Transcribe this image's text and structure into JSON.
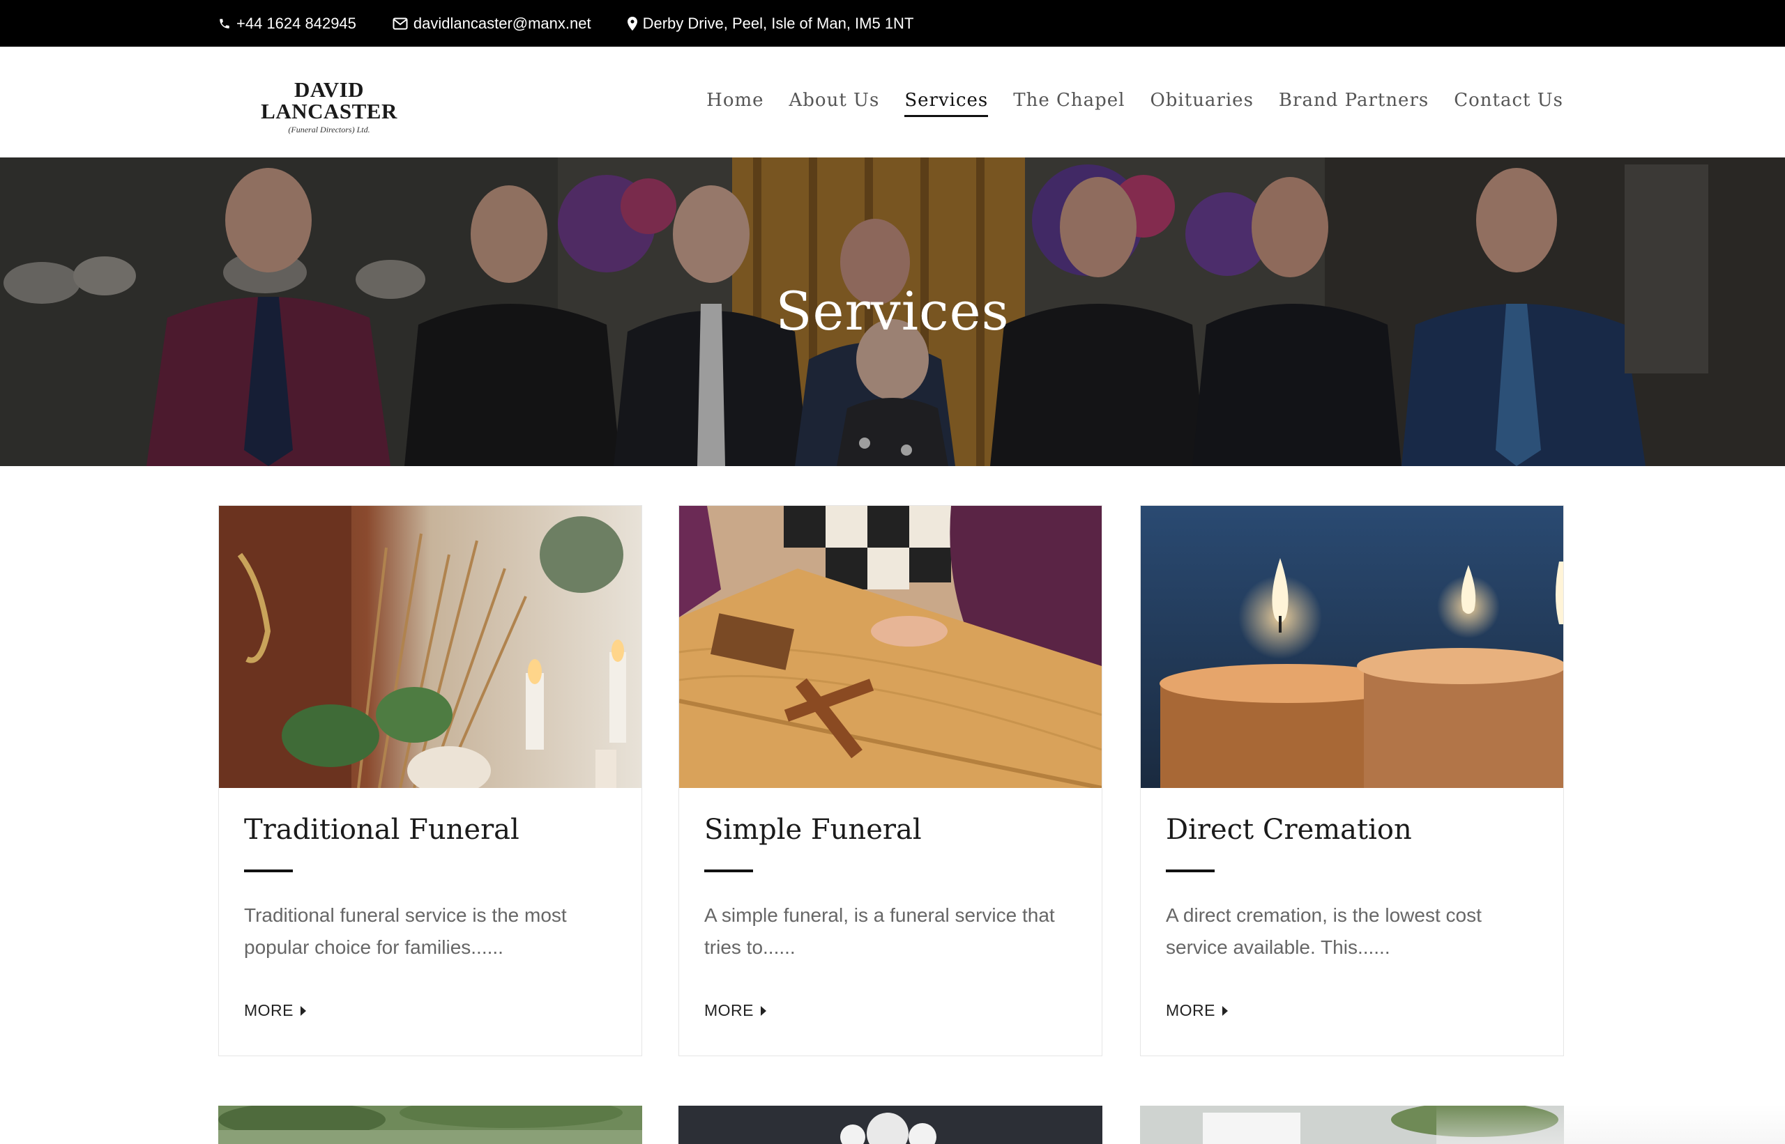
{
  "topbar": {
    "phone": "+44 1624 842945",
    "email": "davidlancaster@manx.net",
    "address": "Derby Drive, Peel, Isle of Man, IM5 1NT",
    "icons": {
      "phone": "phone-icon",
      "email": "envelope-icon",
      "address": "map-marker-icon"
    }
  },
  "logo": {
    "name": "DAVID LANCASTER",
    "subtitle": "(Funeral Directors) Ltd."
  },
  "nav": {
    "items": [
      "Home",
      "About Us",
      "Services",
      "The Chapel",
      "Obituaries",
      "Brand Partners",
      "Contact Us"
    ],
    "active": "Services"
  },
  "hero": {
    "title": "Services"
  },
  "cards": [
    {
      "title": "Traditional Funeral",
      "description": "Traditional funeral service is the most popular choice for families......",
      "more_label": "MORE"
    },
    {
      "title": "Simple Funeral",
      "description": "A simple funeral, is a funeral service that tries to......",
      "more_label": "MORE"
    },
    {
      "title": "Direct Cremation",
      "description": "A direct cremation, is the lowest cost service available. This......",
      "more_label": "MORE"
    }
  ],
  "colors": {
    "topbar_bg": "#000000",
    "nav_active_underline": "#111111",
    "text_muted": "#666666"
  }
}
